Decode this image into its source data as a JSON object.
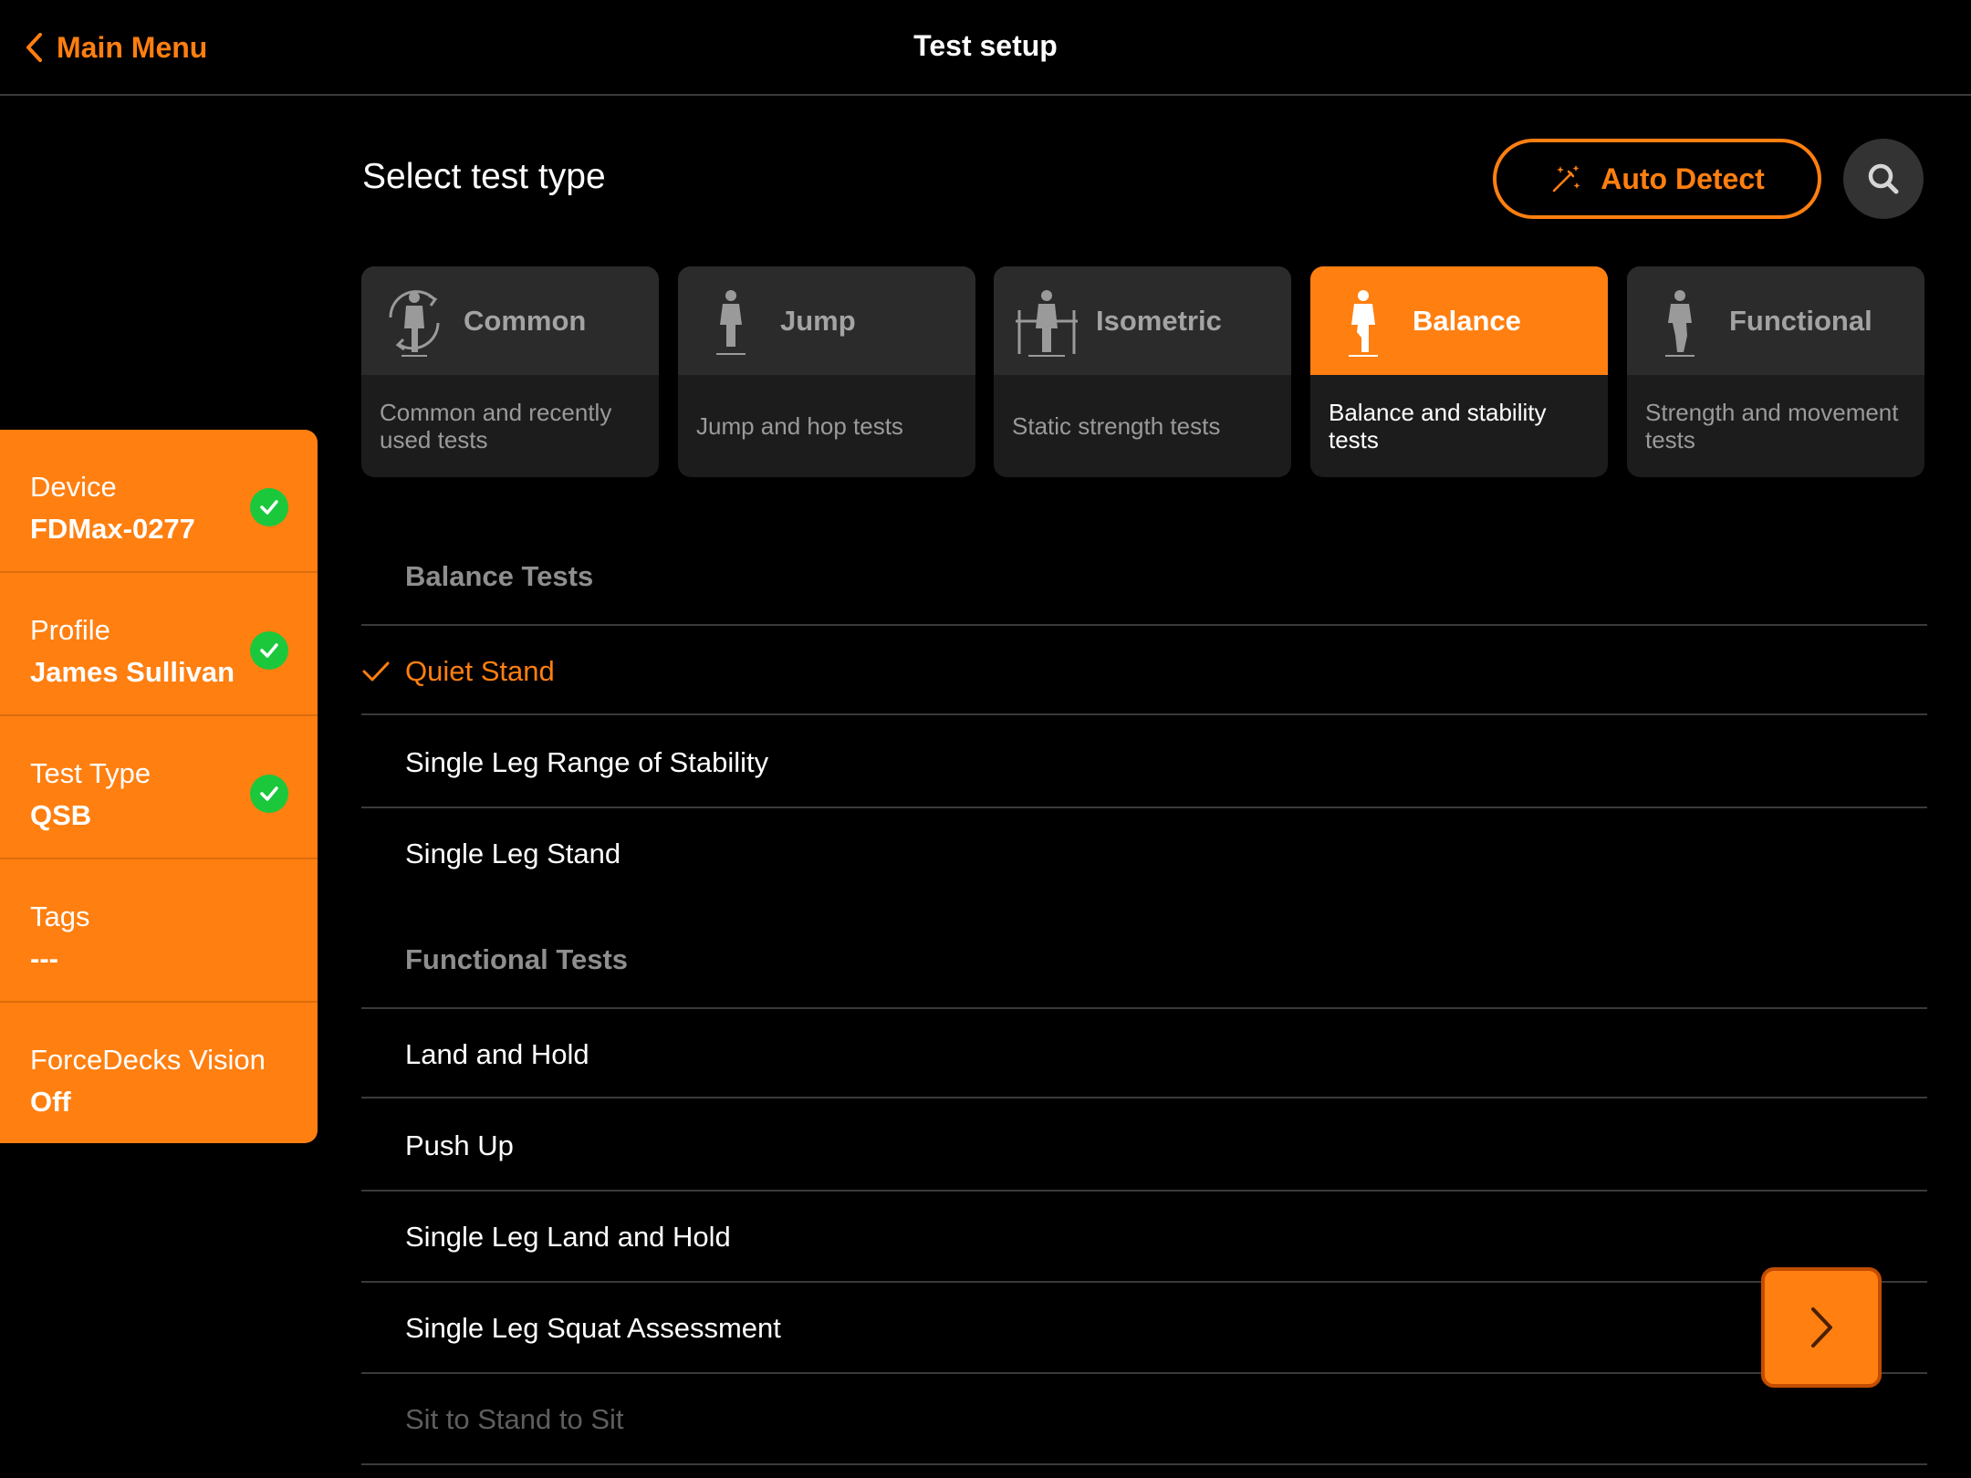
{
  "header": {
    "back_label": "Main Menu",
    "title": "Test setup"
  },
  "status_panel": {
    "items": [
      {
        "label": "Device",
        "value": "FDMax-0277",
        "complete": true
      },
      {
        "label": "Profile",
        "value": "James Sullivan",
        "complete": true
      },
      {
        "label": "Test Type",
        "value": "QSB",
        "complete": true
      },
      {
        "label": "Tags",
        "value": "---",
        "complete": false
      },
      {
        "label": "ForceDecks Vision",
        "value": "Off",
        "complete": false
      }
    ]
  },
  "main": {
    "heading": "Select test type",
    "auto_detect_label": "Auto Detect",
    "categories": [
      {
        "name": "Common",
        "description": "Common and recently used tests",
        "active": false,
        "icon": "rotate-figure-icon"
      },
      {
        "name": "Jump",
        "description": "Jump and hop tests",
        "active": false,
        "icon": "jump-figure-icon"
      },
      {
        "name": "Isometric",
        "description": "Static strength tests",
        "active": false,
        "icon": "isometric-figure-icon"
      },
      {
        "name": "Balance",
        "description": "Balance and stability tests",
        "active": true,
        "icon": "balance-figure-icon"
      },
      {
        "name": "Functional",
        "description": "Strength and movement tests",
        "active": false,
        "icon": "functional-figure-icon"
      }
    ],
    "groups": [
      {
        "title": "Balance Tests",
        "tests": [
          {
            "name": "Quiet Stand",
            "selected": true
          },
          {
            "name": "Single Leg Range of Stability",
            "selected": false
          },
          {
            "name": "Single Leg Stand",
            "selected": false
          }
        ]
      },
      {
        "title": "Functional Tests",
        "tests": [
          {
            "name": "Land and Hold",
            "selected": false
          },
          {
            "name": "Push Up",
            "selected": false
          },
          {
            "name": "Single Leg Land and Hold",
            "selected": false
          },
          {
            "name": "Single Leg Squat Assessment",
            "selected": false
          },
          {
            "name": "Sit to Stand to Sit",
            "selected": false
          }
        ]
      }
    ]
  },
  "colors": {
    "accent": "#ff7f10",
    "success": "#1bc83c",
    "background": "#000000"
  }
}
